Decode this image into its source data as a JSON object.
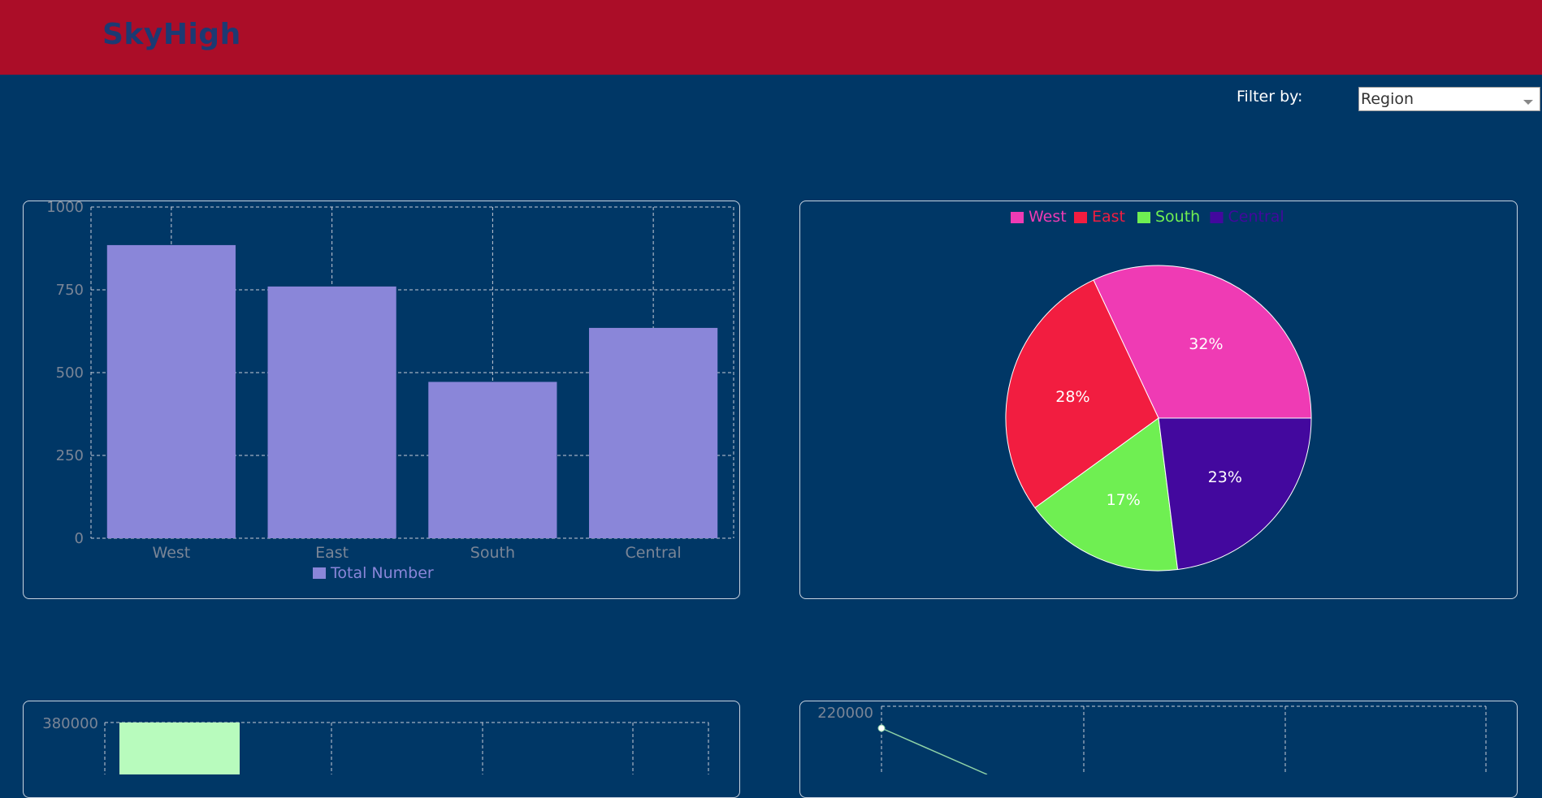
{
  "app": {
    "title": "SkyHigh"
  },
  "filter": {
    "label": "Filter by:",
    "selected": "Region"
  },
  "colors": {
    "header": "#ab0d28",
    "background": "#003766",
    "bar": "#8a86d9",
    "bottom_bar": "#b8fbbd",
    "line": "#8fd3a7"
  },
  "chart_data": [
    {
      "type": "bar",
      "categories": [
        "West",
        "East",
        "South",
        "Central"
      ],
      "series": [
        {
          "name": "Total Number",
          "values": [
            885,
            760,
            472,
            635
          ]
        }
      ],
      "ylim": [
        0,
        1000
      ],
      "yticks": [
        0,
        250,
        500,
        750,
        1000
      ],
      "grid": true,
      "legend": "bottom"
    },
    {
      "type": "pie",
      "labels": [
        "West",
        "East",
        "South",
        "Central"
      ],
      "values": [
        32,
        28,
        17,
        23
      ],
      "value_labels": [
        "32%",
        "28%",
        "17%",
        "23%"
      ],
      "colors": [
        "#ef3bb4",
        "#f21d40",
        "#6fef52",
        "#43089e"
      ],
      "legend": "top"
    },
    {
      "type": "bar",
      "partial": true,
      "top_tick": "380000",
      "values": [
        380000
      ],
      "grid": true
    },
    {
      "type": "line",
      "partial": true,
      "top_tick": "220000",
      "values": [
        210000
      ],
      "grid": true
    }
  ]
}
